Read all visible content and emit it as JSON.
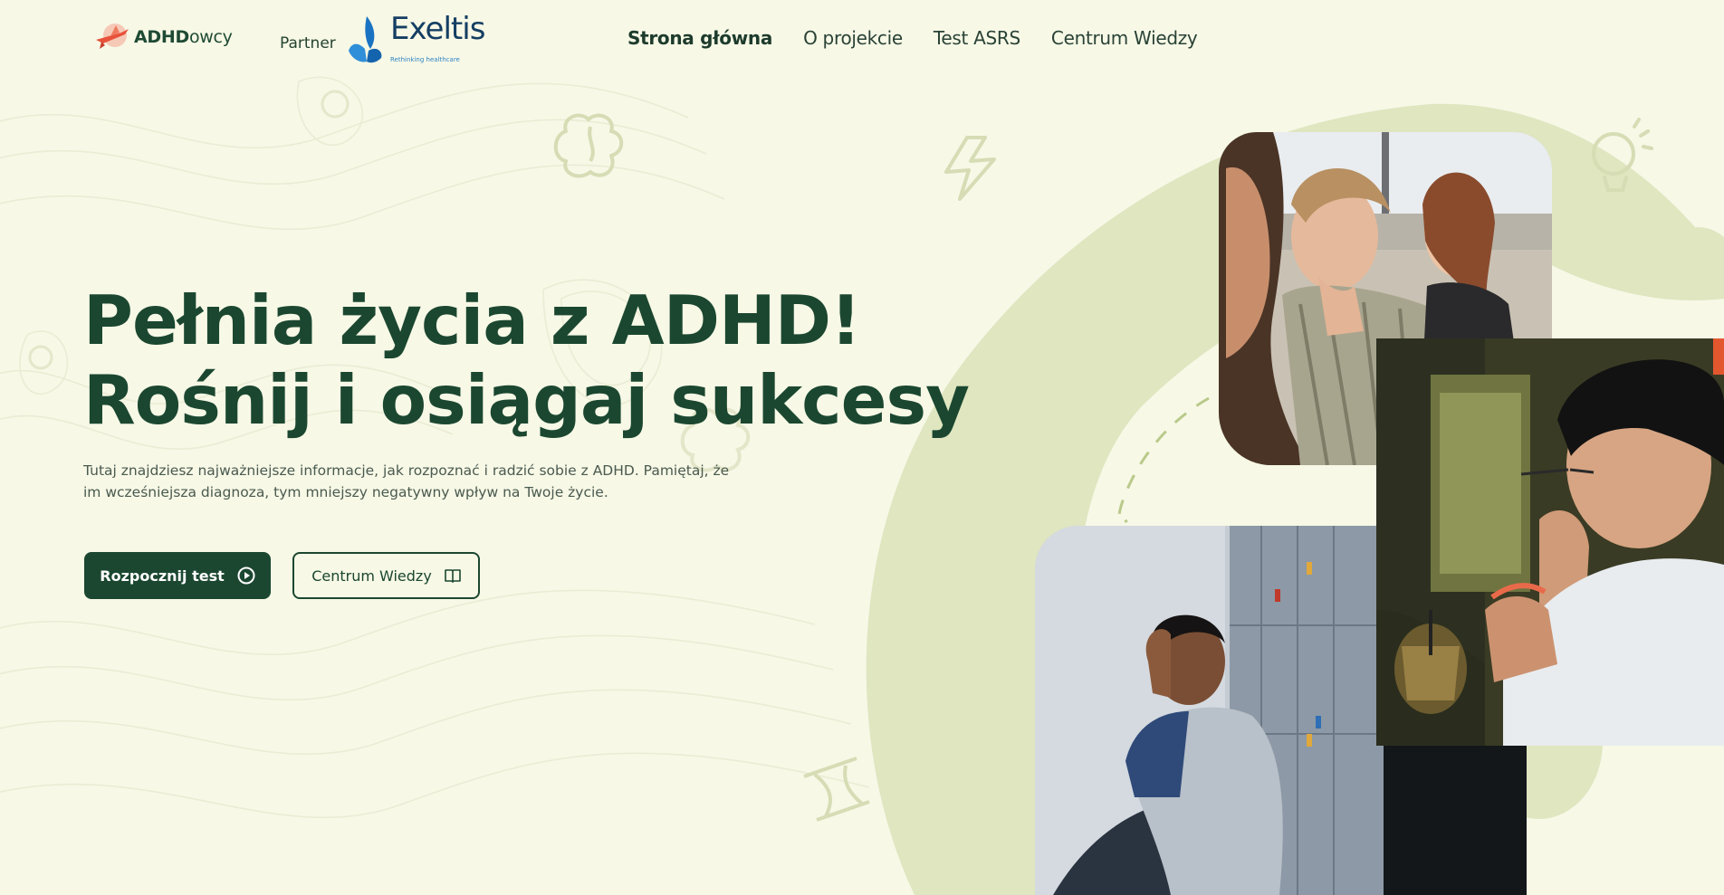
{
  "header": {
    "logo": {
      "strong": "ADHD",
      "light": "owcy"
    },
    "partner_label": "Partner",
    "partner": {
      "name": "Exeltis",
      "tagline": "Rethinking healthcare"
    }
  },
  "nav": {
    "items": [
      {
        "label": "Strona główna",
        "active": true
      },
      {
        "label": "O projekcie",
        "active": false
      },
      {
        "label": "Test ASRS",
        "active": false
      },
      {
        "label": "Centrum Wiedzy",
        "active": false
      }
    ]
  },
  "hero": {
    "title_line1": "Pełnia życia z ADHD!",
    "title_line2": "Rośnij i osiągaj sukcesy",
    "description": "Tutaj znajdziesz najważniejsze informacje, jak rozpoznać i radzić sobie z ADHD. Pamiętaj, że im wcześniejsza diagnoza, tym mniejszy negatywny wpływ na Twoje życie.",
    "primary_button": {
      "label": "Rozpocznij test",
      "icon": "play-circle-icon"
    },
    "secondary_button": {
      "label": "Centrum Wiedzy",
      "icon": "book-icon"
    }
  },
  "colors": {
    "background": "#f7f8e6",
    "accent_green": "#1b4730",
    "light_green": "#dfe6c0",
    "partner_blue": "#153e63"
  }
}
